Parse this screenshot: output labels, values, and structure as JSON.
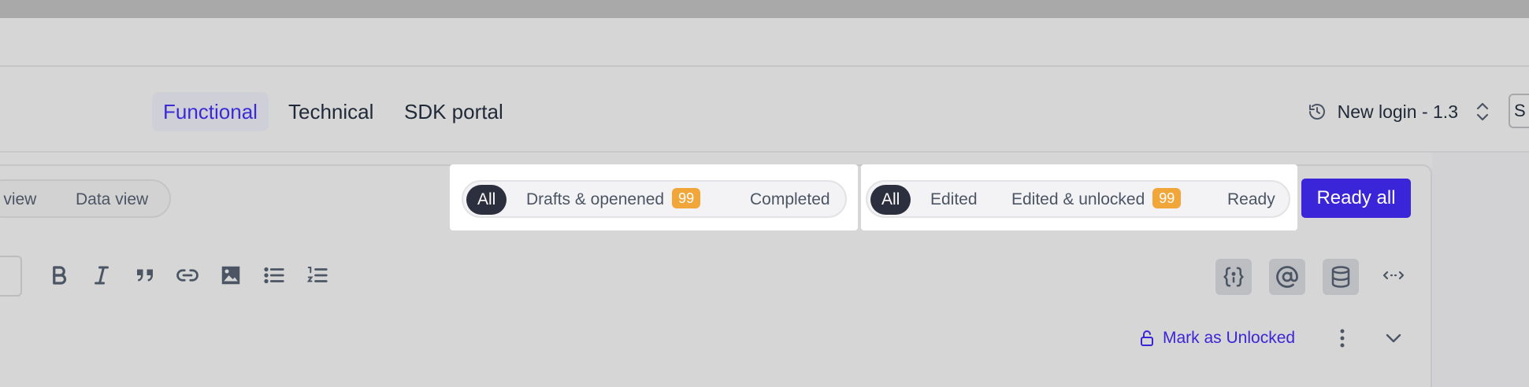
{
  "doc_tabs": [
    {
      "label": "Functional",
      "active": true
    },
    {
      "label": "Technical",
      "active": false
    },
    {
      "label": "SDK portal",
      "active": false
    }
  ],
  "version": {
    "icon": "clock-history-icon",
    "label": "New login - 1.3",
    "toggle_icon": "chevron-up-down-icon"
  },
  "cut_button": {
    "label": "S"
  },
  "view_toggle": {
    "items": [
      "s view",
      "Data view"
    ]
  },
  "filter_status": {
    "pills": [
      {
        "label": "All",
        "active": true
      },
      {
        "label": "Drafts & openened",
        "badge": "99"
      },
      {
        "label": "Completed"
      }
    ]
  },
  "filter_edit": {
    "pills": [
      {
        "label": "All",
        "active": true
      },
      {
        "label": "Edited"
      },
      {
        "label": "Edited & unlocked",
        "badge": "99"
      },
      {
        "label": "Ready"
      }
    ]
  },
  "ready_all": {
    "label": "Ready all"
  },
  "toolbar": {
    "format_icons": [
      "bold-icon",
      "italic-icon",
      "quote-icon",
      "link-icon",
      "image-icon",
      "bullet-list-icon",
      "numbered-list-icon"
    ],
    "insert_icons": [
      "variable-braces-icon",
      "mention-icon",
      "database-icon"
    ],
    "expand_icon": "expand-arrows-icon"
  },
  "lock_action": {
    "label": "Mark as Unlocked",
    "icon": "unlock-icon"
  },
  "more_icon": "more-vertical-icon",
  "collapse_icon": "chevron-down-icon",
  "colors": {
    "accent": "#3b25d8",
    "badge": "#f1a63a",
    "active_pill": "#2b2f3e"
  }
}
